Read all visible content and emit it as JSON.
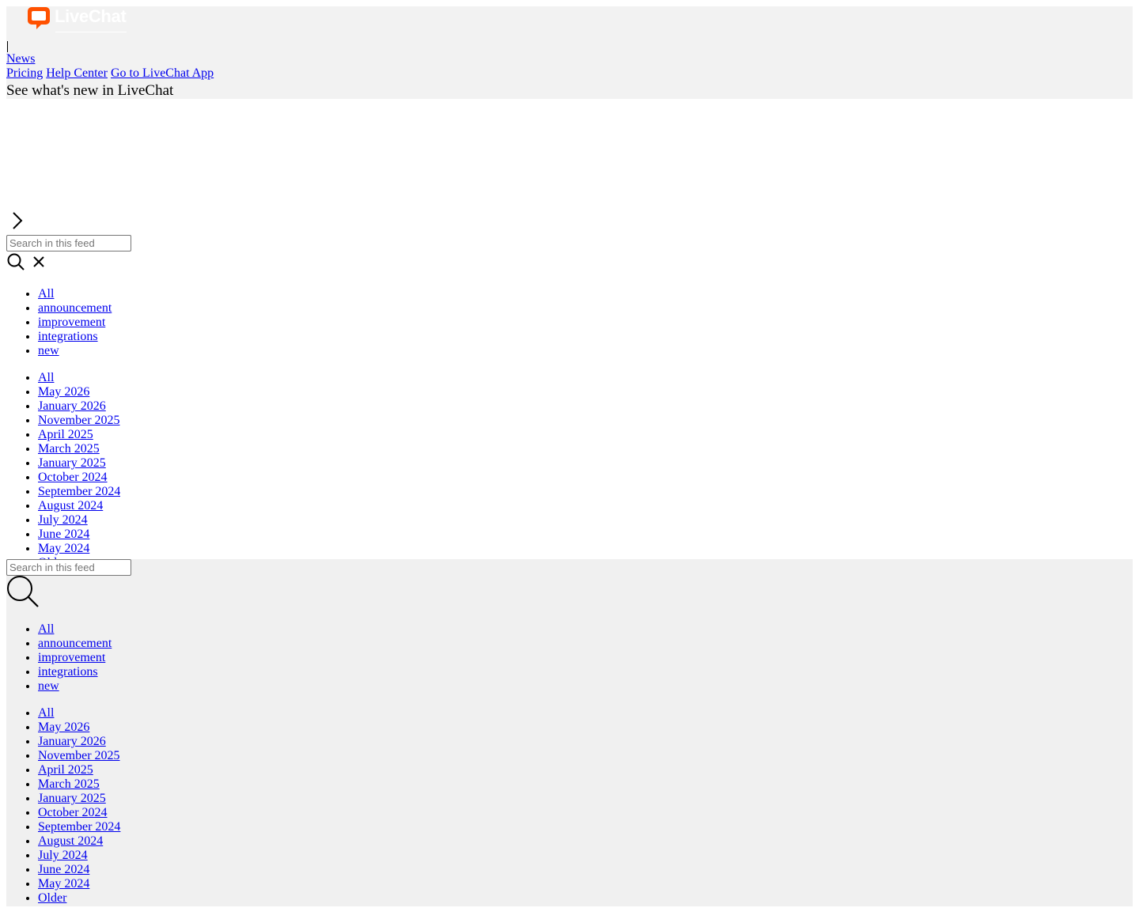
{
  "brand": {
    "name": "LiveChat",
    "accent_color": "#ff5100"
  },
  "header": {
    "nav_news": "News",
    "nav_pricing": "Pricing",
    "nav_help": "Help Center",
    "nav_app": "Go to LiveChat App",
    "title": "See what's new in LiveChat"
  },
  "sidebar": {
    "search_placeholder": "Search in this feed",
    "tags": [
      "All",
      "announcement",
      "improvement",
      "integrations",
      "new"
    ],
    "months": [
      "All",
      "May 2026",
      "January 2026",
      "November 2025",
      "April 2025",
      "March 2025",
      "January 2025",
      "October 2024",
      "September 2024",
      "August 2024",
      "July 2024",
      "June 2024",
      "May 2024",
      "Older"
    ]
  },
  "icons": {
    "expand": "chevron-right-icon",
    "search": "search-icon",
    "clear": "close-icon",
    "logo": "chat-bubble-icon"
  }
}
